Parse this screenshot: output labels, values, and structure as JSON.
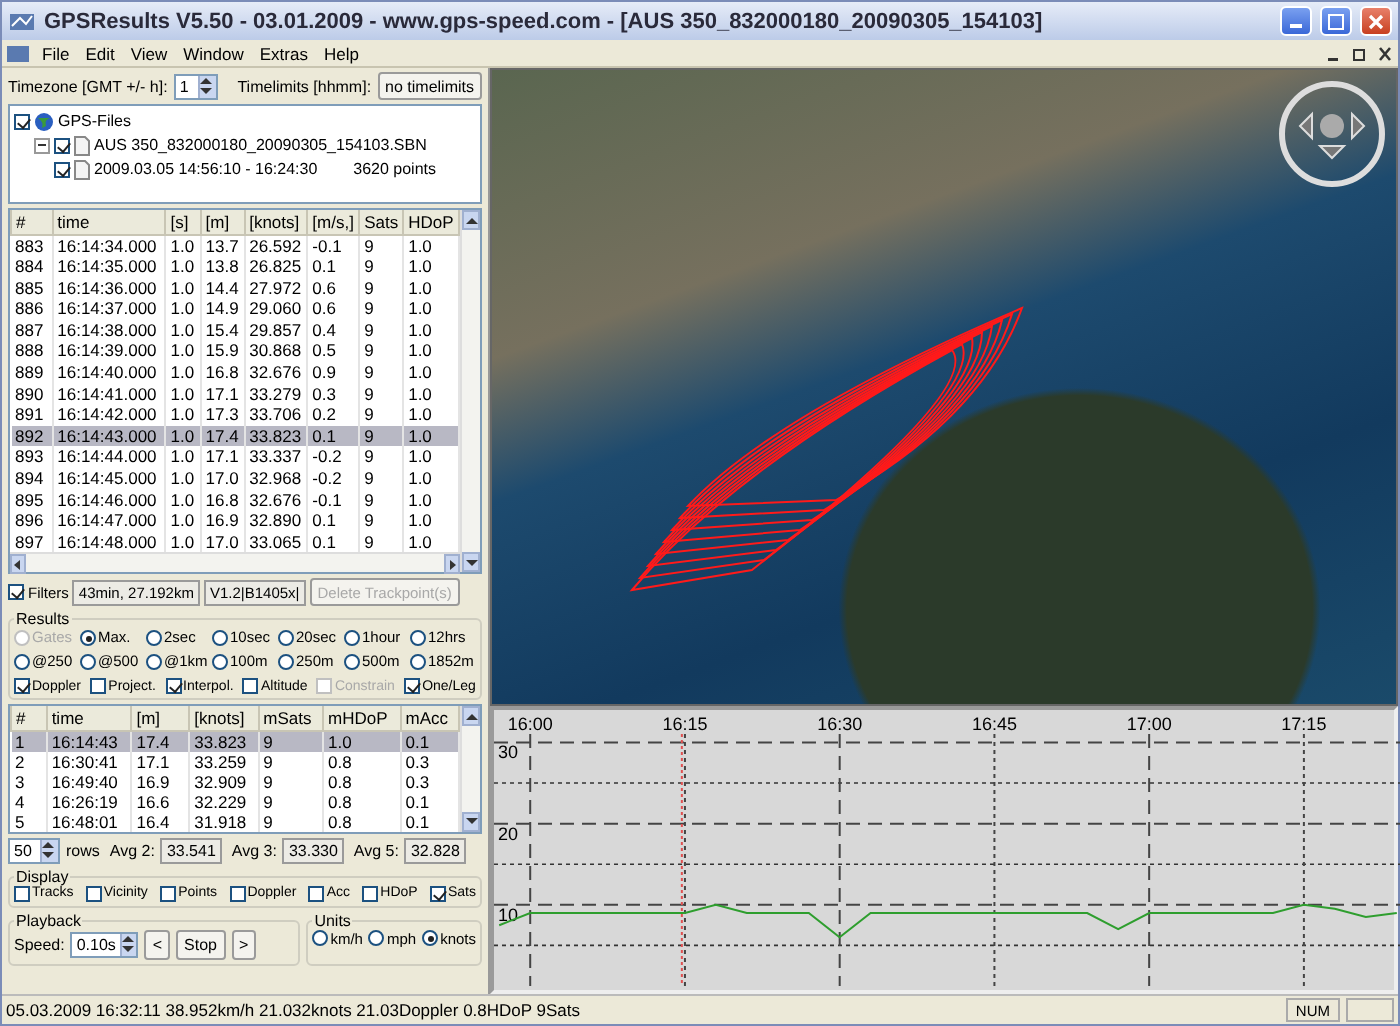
{
  "window": {
    "title": "GPSResults V5.50 - 03.01.2009 - www.gps-speed.com - [AUS 350_832000180_20090305_154103]"
  },
  "menu": [
    "File",
    "Edit",
    "View",
    "Window",
    "Extras",
    "Help"
  ],
  "timezone": {
    "label": "Timezone [GMT +/- h]:",
    "value": "1"
  },
  "timelimits": {
    "label": "Timelimits [hhmm]:",
    "button": "no timelimits"
  },
  "tree": [
    {
      "kind": "root",
      "label": "GPS-Files",
      "checked": true,
      "children": [
        {
          "kind": "file",
          "label": "AUS 350_832000180_20090305_154103.SBN",
          "checked": true,
          "expanded": true,
          "children": [
            {
              "kind": "track",
              "label": "2009.03.05 14:56:10 - 16:24:30",
              "points": "3620 points",
              "checked": true
            }
          ]
        }
      ]
    }
  ],
  "points_table": {
    "columns": [
      "#",
      "time",
      "[s]",
      "[m]",
      "[knots]",
      "[m/s,]",
      "Sats",
      "HDoP"
    ],
    "rows": [
      {
        "cells": [
          "883",
          "16:14:34.000",
          "1.0",
          "13.7",
          "26.592",
          "-0.1",
          "9",
          "1.0"
        ],
        "selected": false
      },
      {
        "cells": [
          "884",
          "16:14:35.000",
          "1.0",
          "13.8",
          "26.825",
          "0.1",
          "9",
          "1.0"
        ],
        "selected": false
      },
      {
        "cells": [
          "885",
          "16:14:36.000",
          "1.0",
          "14.4",
          "27.972",
          "0.6",
          "9",
          "1.0"
        ],
        "selected": false
      },
      {
        "cells": [
          "886",
          "16:14:37.000",
          "1.0",
          "14.9",
          "29.060",
          "0.6",
          "9",
          "1.0"
        ],
        "selected": false
      },
      {
        "cells": [
          "887",
          "16:14:38.000",
          "1.0",
          "15.4",
          "29.857",
          "0.4",
          "9",
          "1.0"
        ],
        "selected": false
      },
      {
        "cells": [
          "888",
          "16:14:39.000",
          "1.0",
          "15.9",
          "30.868",
          "0.5",
          "9",
          "1.0"
        ],
        "selected": false
      },
      {
        "cells": [
          "889",
          "16:14:40.000",
          "1.0",
          "16.8",
          "32.676",
          "0.9",
          "9",
          "1.0"
        ],
        "selected": false
      },
      {
        "cells": [
          "890",
          "16:14:41.000",
          "1.0",
          "17.1",
          "33.279",
          "0.3",
          "9",
          "1.0"
        ],
        "selected": false
      },
      {
        "cells": [
          "891",
          "16:14:42.000",
          "1.0",
          "17.3",
          "33.706",
          "0.2",
          "9",
          "1.0"
        ],
        "selected": false
      },
      {
        "cells": [
          "892",
          "16:14:43.000",
          "1.0",
          "17.4",
          "33.823",
          "0.1",
          "9",
          "1.0"
        ],
        "selected": true
      },
      {
        "cells": [
          "893",
          "16:14:44.000",
          "1.0",
          "17.1",
          "33.337",
          "-0.2",
          "9",
          "1.0"
        ],
        "selected": false
      },
      {
        "cells": [
          "894",
          "16:14:45.000",
          "1.0",
          "17.0",
          "32.968",
          "-0.2",
          "9",
          "1.0"
        ],
        "selected": false
      },
      {
        "cells": [
          "895",
          "16:14:46.000",
          "1.0",
          "16.8",
          "32.676",
          "-0.1",
          "9",
          "1.0"
        ],
        "selected": false
      },
      {
        "cells": [
          "896",
          "16:14:47.000",
          "1.0",
          "16.9",
          "32.890",
          "0.1",
          "9",
          "1.0"
        ],
        "selected": false
      },
      {
        "cells": [
          "897",
          "16:14:48.000",
          "1.0",
          "17.0",
          "33.065",
          "0.1",
          "9",
          "1.0"
        ],
        "selected": false
      }
    ]
  },
  "filters": {
    "label": "Filters",
    "checked": true,
    "summary": "43min, 27.192km",
    "version": "V1.2|B1405x|",
    "delete_button": {
      "label": "Delete Trackpoint(s)",
      "disabled": true
    }
  },
  "results": {
    "title": "Results",
    "options": [
      {
        "label": "Gates",
        "selected": false,
        "disabled": true
      },
      {
        "label": "Max.",
        "selected": true,
        "disabled": false
      },
      {
        "label": "2sec",
        "selected": false,
        "disabled": false
      },
      {
        "label": "10sec",
        "selected": false,
        "disabled": false
      },
      {
        "label": "20sec",
        "selected": false,
        "disabled": false
      },
      {
        "label": "1hour",
        "selected": false,
        "disabled": false
      },
      {
        "label": "12hrs",
        "selected": false,
        "disabled": false
      },
      {
        "label": "@250",
        "selected": false,
        "disabled": false
      },
      {
        "label": "@500",
        "selected": false,
        "disabled": false
      },
      {
        "label": "@1km",
        "selected": false,
        "disabled": false
      },
      {
        "label": "100m",
        "selected": false,
        "disabled": false
      },
      {
        "label": "250m",
        "selected": false,
        "disabled": false
      },
      {
        "label": "500m",
        "selected": false,
        "disabled": false
      },
      {
        "label": "1852m",
        "selected": false,
        "disabled": false
      }
    ],
    "checks": [
      {
        "label": "Doppler",
        "checked": true,
        "disabled": false
      },
      {
        "label": "Project.",
        "checked": false,
        "disabled": false
      },
      {
        "label": "Interpol.",
        "checked": true,
        "disabled": false
      },
      {
        "label": "Altitude",
        "checked": false,
        "disabled": false
      },
      {
        "label": "Constrain",
        "checked": false,
        "disabled": true
      },
      {
        "label": "One/Leg",
        "checked": true,
        "disabled": false
      }
    ],
    "table": {
      "columns": [
        "#",
        "time",
        "[m]",
        "[knots]",
        "mSats",
        "mHDoP",
        "mAcc"
      ],
      "rows": [
        {
          "cells": [
            "1",
            "16:14:43",
            "17.4",
            "33.823",
            "9",
            "1.0",
            "0.1"
          ],
          "selected": true
        },
        {
          "cells": [
            "2",
            "16:30:41",
            "17.1",
            "33.259",
            "9",
            "0.8",
            "0.3"
          ],
          "selected": false
        },
        {
          "cells": [
            "3",
            "16:49:40",
            "16.9",
            "32.909",
            "9",
            "0.8",
            "0.3"
          ],
          "selected": false
        },
        {
          "cells": [
            "4",
            "16:26:19",
            "16.6",
            "32.229",
            "9",
            "0.8",
            "0.1"
          ],
          "selected": false
        },
        {
          "cells": [
            "5",
            "16:48:01",
            "16.4",
            "31.918",
            "9",
            "0.8",
            "0.1"
          ],
          "selected": false
        }
      ]
    }
  },
  "averages": {
    "rows_value": "50",
    "rows_label": "rows",
    "items": [
      {
        "label": "Avg 2:",
        "value": "33.541"
      },
      {
        "label": "Avg 3:",
        "value": "33.330"
      },
      {
        "label": "Avg 5:",
        "value": "32.828"
      }
    ]
  },
  "display": {
    "title": "Display",
    "checks": [
      {
        "label": "Tracks",
        "checked": false
      },
      {
        "label": "Vicinity",
        "checked": false
      },
      {
        "label": "Points",
        "checked": false
      },
      {
        "label": "Doppler",
        "checked": false
      },
      {
        "label": "Acc",
        "checked": false
      },
      {
        "label": "HDoP",
        "checked": false
      },
      {
        "label": "Sats",
        "checked": true
      }
    ]
  },
  "playback": {
    "title": "Playback",
    "speed_label": "Speed:",
    "speed": "0.10s",
    "buttons": [
      "<",
      "Stop",
      ">"
    ]
  },
  "units": {
    "title": "Units",
    "options": [
      {
        "label": "km/h",
        "selected": false
      },
      {
        "label": "mph",
        "selected": false
      },
      {
        "label": "knots",
        "selected": true
      }
    ]
  },
  "chart": {
    "chart_data": {
      "type": "line",
      "ylim": [
        0,
        34
      ],
      "yticks": [
        10,
        20,
        30
      ],
      "categories": [
        null,
        "16:00",
        null,
        null,
        null,
        null,
        "16:15",
        null,
        null,
        null,
        null,
        "16:30",
        null,
        null,
        null,
        null,
        "16:45",
        null,
        null,
        null,
        null,
        "17:00",
        null,
        null,
        null,
        null,
        "17:15",
        null,
        null,
        null
      ],
      "series": [
        {
          "color": "#2e9e2e",
          "values": [
            7.5,
            9,
            9,
            9,
            9,
            9,
            9,
            10,
            9,
            9,
            9,
            6,
            9,
            9,
            9,
            9,
            9,
            9,
            9,
            9,
            7,
            9,
            9,
            9,
            9,
            9,
            10,
            9.5,
            8.5,
            9
          ]
        }
      ],
      "grid": true
    }
  },
  "status_bar": {
    "text": "05.03.2009 16:32:11 38.952km/h 21.032knots 21.03Doppler  0.8HDoP  9Sats",
    "panels": [
      "NUM"
    ]
  }
}
